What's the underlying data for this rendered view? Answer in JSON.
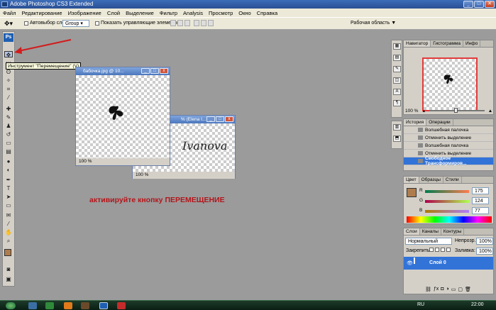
{
  "window": {
    "title": "Adobe Photoshop CS3 Extended",
    "min": "_",
    "max": "□",
    "close": "✕"
  },
  "menu": [
    "Файл",
    "Редактирование",
    "Изображение",
    "Слой",
    "Выделение",
    "Фильтр",
    "Analysis",
    "Просмотр",
    "Окно",
    "Справка"
  ],
  "options": {
    "autoselect_label": "Автовыбор слоя:",
    "autoselect_value": "Group",
    "show_controls_label": "Показать управляющие элементы",
    "workspace_label": "Рабочая область ▼"
  },
  "toolbox": {
    "ps_label": "Ps"
  },
  "tooltip": "Инструмент \"Перемещение\" (V)",
  "doc1": {
    "title": "бабочка.jpg @ 10...",
    "zoom": "100 %"
  },
  "doc2": {
    "title": "% (Elena I...",
    "zoom": "100 %",
    "canvas_text": "Ivanova"
  },
  "instruction": {
    "prefix": "активируйте кнопку ",
    "strong": "ПЕРЕМЕЩЕНИЕ"
  },
  "navigator": {
    "tabs": [
      "Навигатор",
      "Гистограмма",
      "Инфо"
    ],
    "zoom": "100 %"
  },
  "history": {
    "tabs": [
      "История",
      "Операции"
    ],
    "items": [
      "Волшебная палочка",
      "Отменить выделение",
      "Волшебная палочка",
      "Отменить выделение",
      "Свободное Трансформиров..."
    ],
    "selected_index": 4
  },
  "color": {
    "tabs": [
      "Цвет",
      "Образцы",
      "Стили"
    ],
    "channels": [
      {
        "label": "R",
        "value": "175"
      },
      {
        "label": "G",
        "value": "124"
      },
      {
        "label": "B",
        "value": "77"
      }
    ],
    "fg_color": "#af7c4d"
  },
  "layers": {
    "tabs": [
      "Слои",
      "Каналы",
      "Контуры"
    ],
    "blend_mode": "Нормальный",
    "opacity_label": "Непрозр.:",
    "opacity_value": "100%",
    "lock_label": "Закрепить:",
    "fill_label": "Заливка:",
    "fill_value": "100%",
    "layer_name": "Слой 0"
  },
  "taskbar": {
    "lang": "RU",
    "time": "22:00"
  }
}
